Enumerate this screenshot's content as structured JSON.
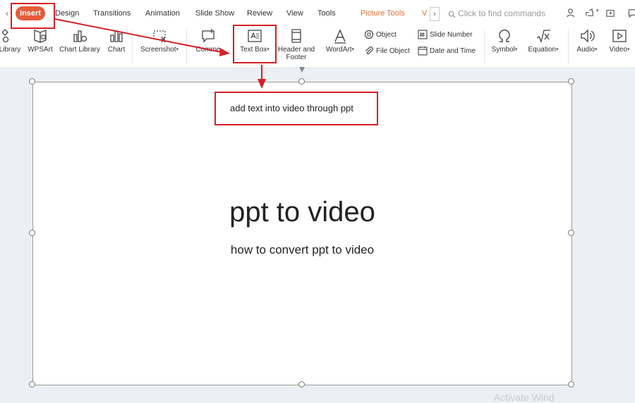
{
  "tabs": {
    "active": "Insert",
    "design": "Design",
    "transitions": "Transitions",
    "animation": "Animation",
    "slide_show": "Slide Show",
    "review": "Review",
    "view": "View",
    "tools": "Tools",
    "picture_tools": "Picture Tools",
    "v_tab": "V",
    "search_placeholder": "Click to find commands"
  },
  "ribbon": {
    "library": "Library",
    "wpsart": "WPSArt",
    "chart_library": "Chart Library",
    "chart": "Chart",
    "screenshot": "Screenshot",
    "comment": "Comme",
    "text_box": "Text Box",
    "header_footer_1": "Header and",
    "header_footer_2": "Footer",
    "wordart": "WordArt",
    "object": "Object",
    "file_object": "File Object",
    "slide_number": "Slide Number",
    "date_time": "Date and Time",
    "symbol": "Symbol",
    "equation": "Equation",
    "audio": "Audio",
    "video": "Video"
  },
  "slide": {
    "title": "ppt to video",
    "subtitle": "how to convert ppt to video"
  },
  "annotation": {
    "callout_text": "add text into video through ppt",
    "color": "#d61f26"
  },
  "watermark": "Activate Wind"
}
